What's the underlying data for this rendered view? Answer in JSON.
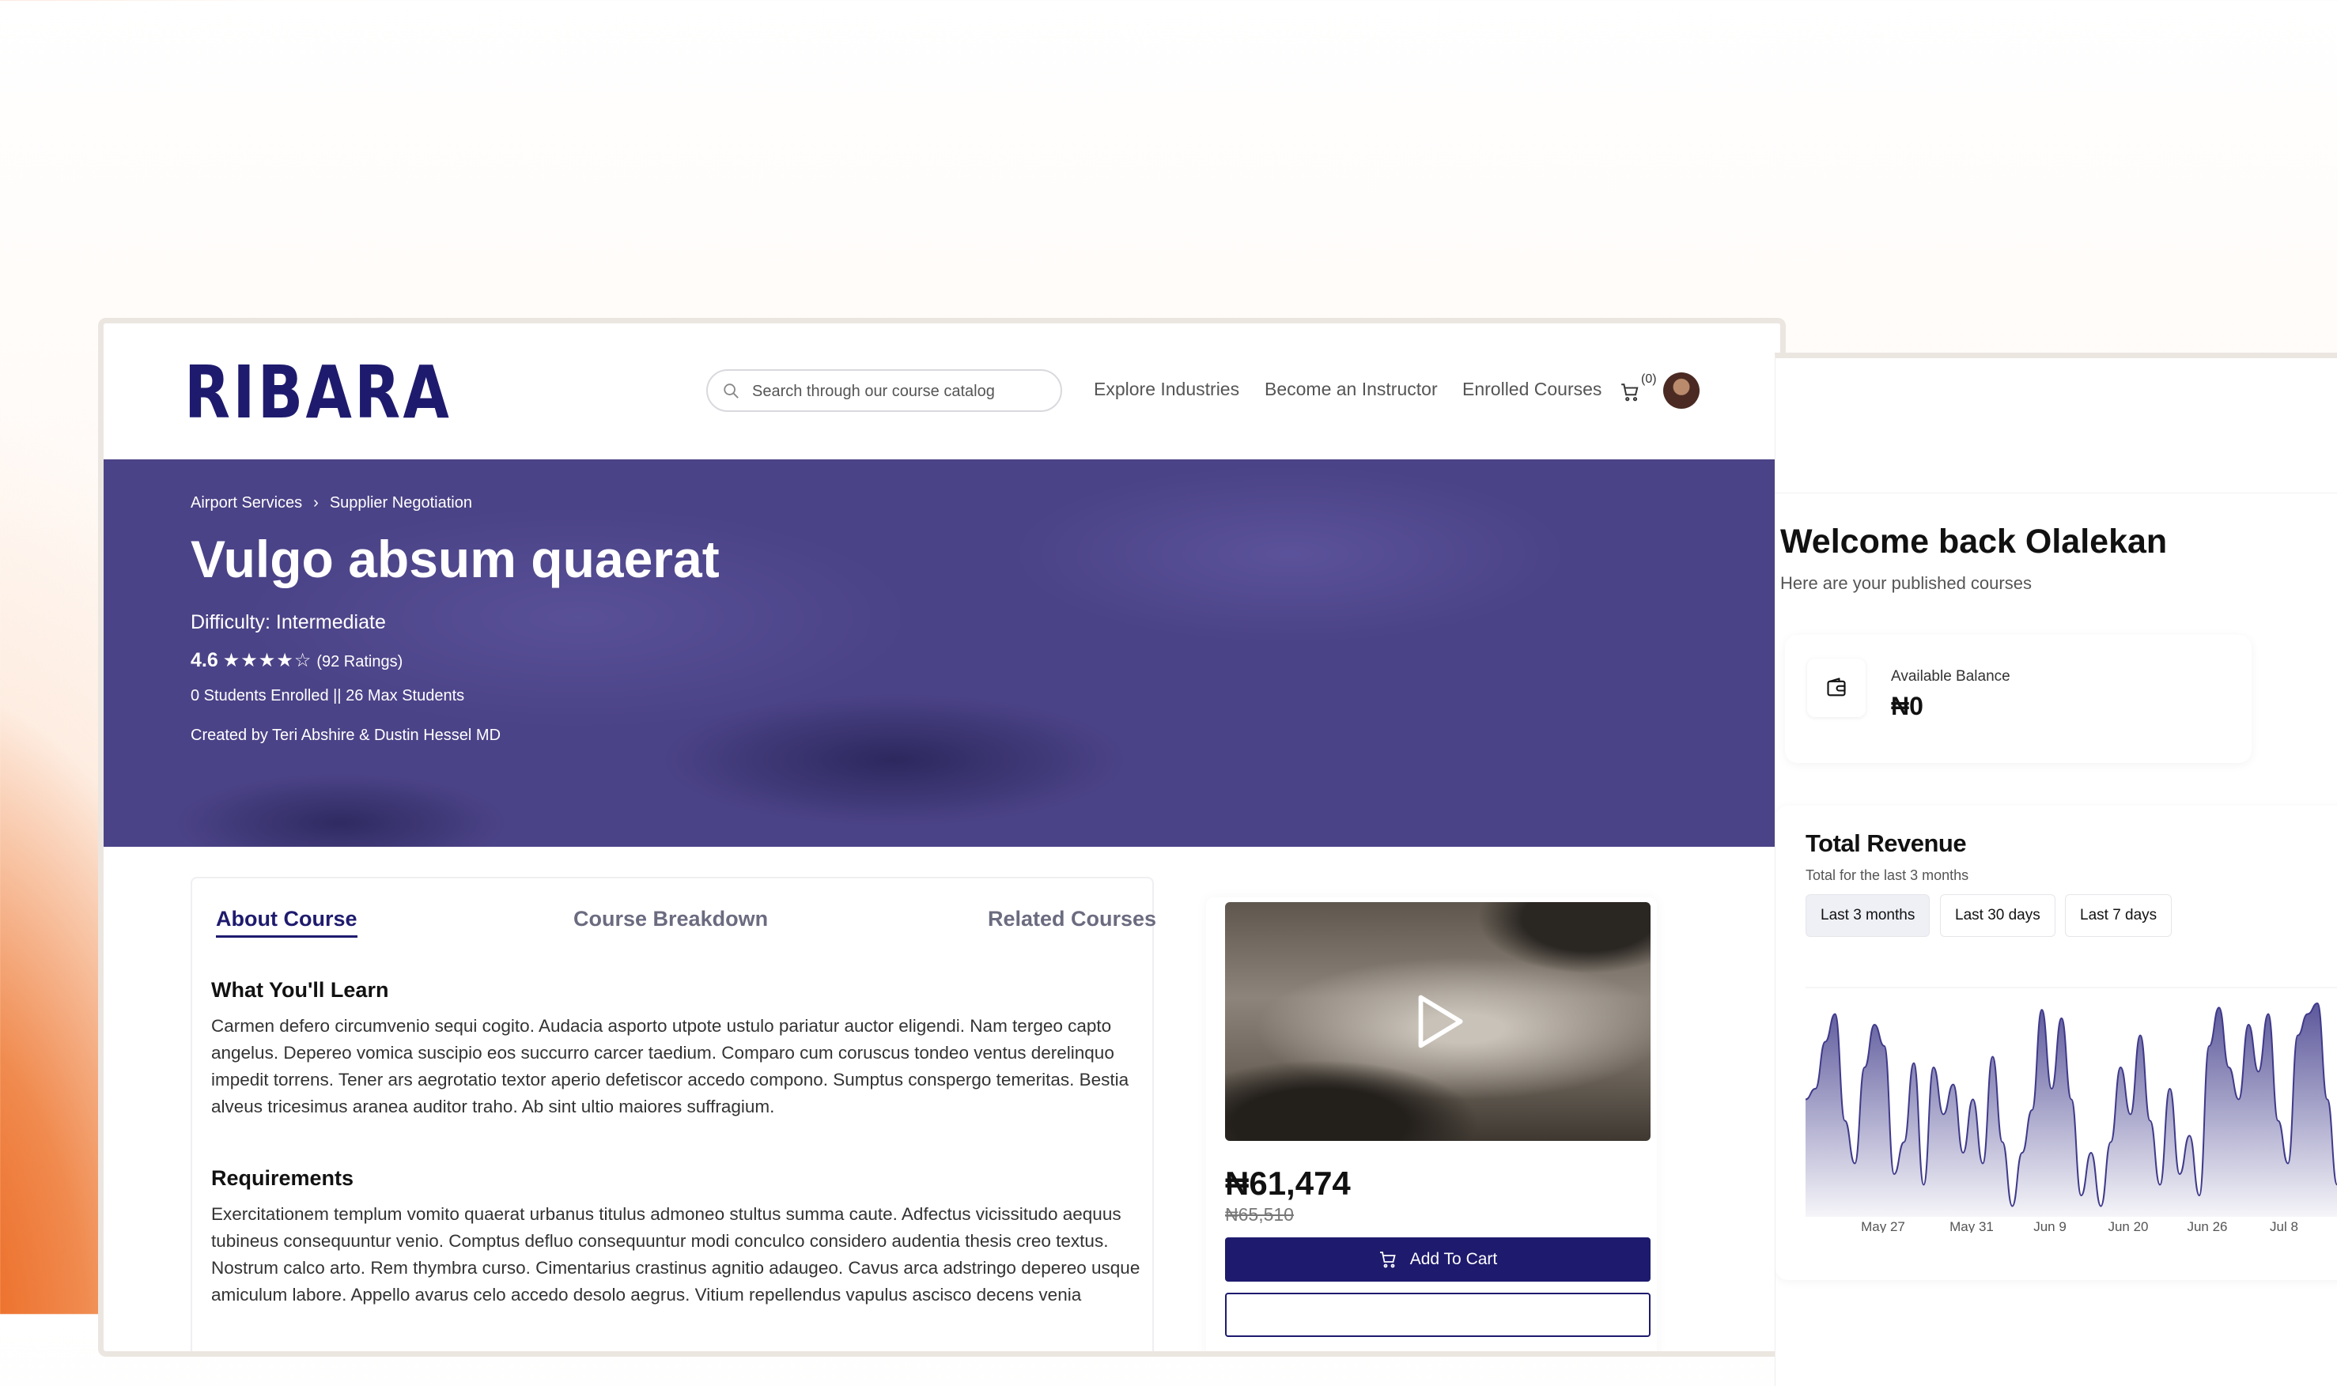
{
  "header": {
    "logo": "RIBARA",
    "search_placeholder": "Search through our course catalog",
    "nav": [
      "Explore Industries",
      "Become an Instructor",
      "Enrolled Courses"
    ],
    "cart_count": "(0)"
  },
  "hero": {
    "breadcrumb": [
      "Airport Services",
      "Supplier Negotiation"
    ],
    "title": "Vulgo absum quaerat",
    "difficulty": "Difficulty: Intermediate",
    "rating": "4.6",
    "stars": "★★★★☆",
    "ratings_count": "(92 Ratings)",
    "students": "0 Students Enrolled || 26 Max Students",
    "created_by": "Created by Teri Abshire & Dustin Hessel MD"
  },
  "tabs": [
    "About Course",
    "Course Breakdown",
    "Related Courses"
  ],
  "about": {
    "learn_heading": "What You'll Learn",
    "learn_text": "Carmen defero circumvenio sequi cogito. Audacia asporto utpote ustulo pariatur auctor eligendi. Nam tergeo capto angelus. Depereo vomica suscipio eos succurro carcer taedium. Comparo cum coruscus tondeo ventus derelinquo impedit torrens. Tener ars aegrotatio textor aperio defetiscor accedo compono. Sumptus conspergo temeritas. Bestia alveus tricesimus aranea auditor traho. Ab sint ultio maiores suffragium.",
    "req_heading": "Requirements",
    "req_text": "Exercitationem templum vomito quaerat urbanus titulus admoneo stultus summa caute. Adfectus vicissitudo aequus tubineus consequuntur venio. Comptus defluo consequuntur modi conculco considero audentia thesis creo textus. Nostrum calco arto. Rem thymbra curso. Cimentarius crastinus agnitio adaugeo. Cavus arca adstringo depereo usque amiculum labore. Appello avarus celo accedo desolo aegrus. Vitium repellendus vapulus ascisco decens venia"
  },
  "purchase": {
    "price": "₦61,474",
    "old_price": "₦65,510",
    "add_to_cart": "Add To Cart"
  },
  "dashboard": {
    "welcome": "Welcome back Olalekan",
    "subtitle": "Here are your published courses",
    "balance_label": "Available Balance",
    "balance_value": "₦0",
    "revenue_title": "Total Revenue",
    "revenue_sub": "Total for the last 3 months",
    "ranges": [
      "Last 3 months",
      "Last 30 days",
      "Last 7 days"
    ],
    "active_range": "Last 3 months"
  },
  "chart_data": {
    "type": "area",
    "x_ticks": [
      "May 27",
      "May 31",
      "Jun 9",
      "Jun 20",
      "Jun 26",
      "Jul 8"
    ],
    "y_relative": [
      0.55,
      0.6,
      0.82,
      0.95,
      0.45,
      0.25,
      0.7,
      0.9,
      0.8,
      0.2,
      0.35,
      0.72,
      0.15,
      0.7,
      0.48,
      0.62,
      0.3,
      0.55,
      0.25,
      0.75,
      0.35,
      0.05,
      0.3,
      0.5,
      0.97,
      0.6,
      0.93,
      0.55,
      0.1,
      0.3,
      0.05,
      0.35,
      0.7,
      0.48,
      0.85,
      0.45,
      0.15,
      0.6,
      0.2,
      0.38,
      0.1,
      0.8,
      0.98,
      0.7,
      0.55,
      0.9,
      0.68,
      0.95,
      0.45,
      0.25,
      0.85,
      0.95,
      1.0,
      0.55,
      0.15,
      0.72,
      0.98,
      0.85,
      0.75
    ],
    "grid": true,
    "legend": "none"
  }
}
